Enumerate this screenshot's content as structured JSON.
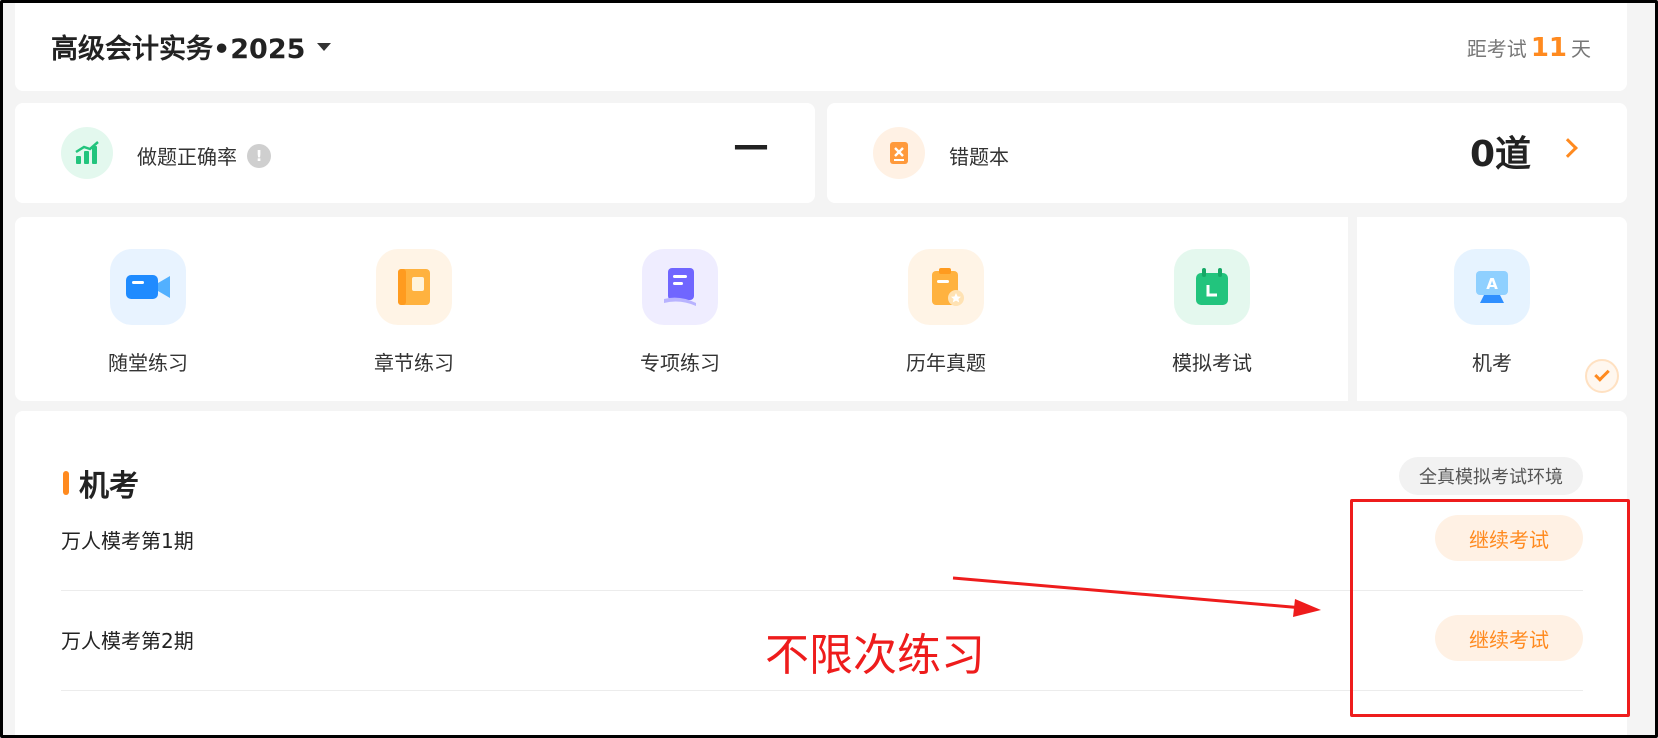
{
  "header": {
    "course_title": "高级会计实务•2025",
    "countdown_prefix": "距考试",
    "countdown_days": "11",
    "countdown_suffix": "天"
  },
  "stats": {
    "accuracy_label": "做题正确率",
    "accuracy_info": "!",
    "accuracy_value": "—",
    "wrongbook_label": "错题本",
    "wrongbook_value": "0道"
  },
  "modes": [
    {
      "label": "随堂练习",
      "icon": "video-icon",
      "color": "#1f8bff"
    },
    {
      "label": "章节练习",
      "icon": "book-icon",
      "color": "#ffb23f"
    },
    {
      "label": "专项练习",
      "icon": "document-icon",
      "color": "#7066ff"
    },
    {
      "label": "历年真题",
      "icon": "clipboard-star-icon",
      "color": "#ffb23f"
    },
    {
      "label": "模拟考试",
      "icon": "calendar-icon",
      "color": "#22c47d"
    },
    {
      "label": "机考",
      "icon": "computer-exam-icon",
      "color": "#3aa0ff",
      "selected": true
    }
  ],
  "section": {
    "title": "机考",
    "badge": "全真模拟考试环境"
  },
  "exams": [
    {
      "title": "万人模考第1期",
      "action": "继续考试"
    },
    {
      "title": "万人模考第2期",
      "action": "继续考试"
    }
  ],
  "annotation": {
    "text": "不限次练习",
    "color": "#ee1c1c"
  },
  "colors": {
    "accent": "#ff8a1f",
    "accent_light": "#fff1e4"
  }
}
